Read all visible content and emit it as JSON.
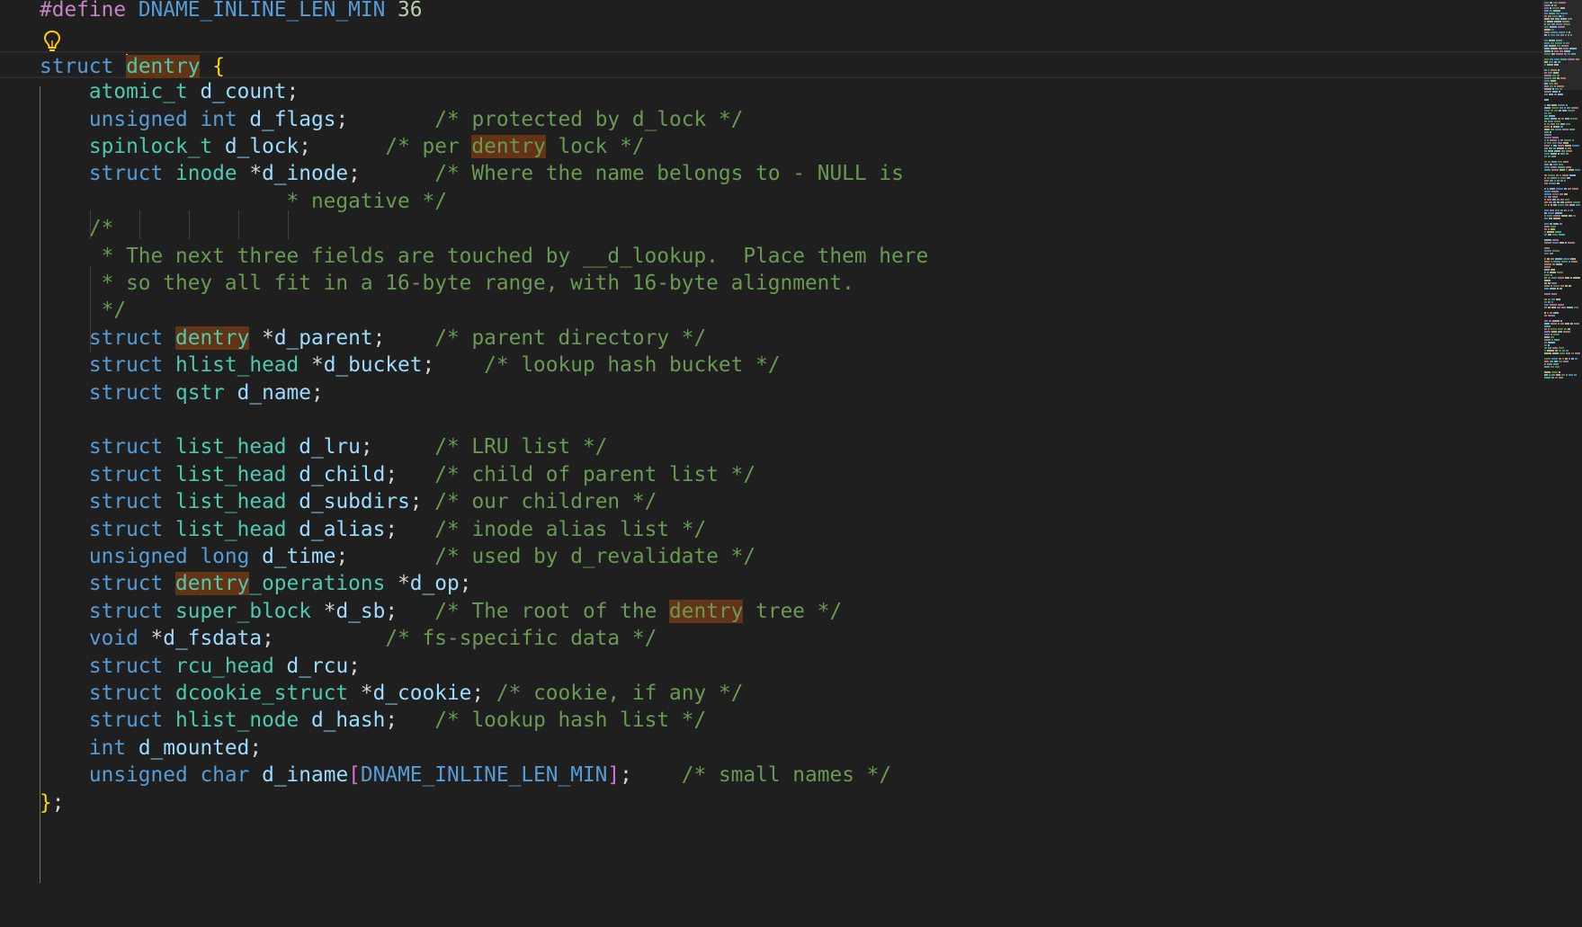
{
  "editor": {
    "language": "c",
    "highlight_word": "dentry",
    "lines": [
      [
        [
          "pp",
          "#define"
        ],
        [
          "pn",
          " "
        ],
        [
          "mac",
          "DNAME_INLINE_LEN_MIN"
        ],
        [
          "pn",
          " "
        ],
        [
          "num",
          "36"
        ]
      ],
      [],
      [
        [
          "kw",
          "struct"
        ],
        [
          "pn",
          " "
        ],
        [
          "caret",
          ""
        ],
        [
          "ty hl",
          "dentry"
        ],
        [
          "pn",
          " "
        ],
        [
          "br",
          "{"
        ]
      ],
      [
        [
          "pn",
          "    "
        ],
        [
          "ty",
          "atomic_t"
        ],
        [
          "pn",
          " "
        ],
        [
          "id",
          "d_count"
        ],
        [
          "pn",
          ";"
        ]
      ],
      [
        [
          "pn",
          "    "
        ],
        [
          "kw",
          "unsigned"
        ],
        [
          "pn",
          " "
        ],
        [
          "kw",
          "int"
        ],
        [
          "pn",
          " "
        ],
        [
          "id",
          "d_flags"
        ],
        [
          "pn",
          ";"
        ],
        [
          "pn",
          "       "
        ],
        [
          "cm",
          "/* protected by d_lock */"
        ]
      ],
      [
        [
          "pn",
          "    "
        ],
        [
          "ty",
          "spinlock_t"
        ],
        [
          "pn",
          " "
        ],
        [
          "id",
          "d_lock"
        ],
        [
          "pn",
          ";"
        ],
        [
          "pn",
          "      "
        ],
        [
          "cm",
          "/* per "
        ],
        [
          "cm hl",
          "dentry"
        ],
        [
          "cm",
          " lock */"
        ]
      ],
      [
        [
          "pn",
          "    "
        ],
        [
          "kw",
          "struct"
        ],
        [
          "pn",
          " "
        ],
        [
          "ty",
          "inode"
        ],
        [
          "pn",
          " *"
        ],
        [
          "id",
          "d_inode"
        ],
        [
          "pn",
          ";"
        ],
        [
          "pn",
          "      "
        ],
        [
          "cm",
          "/* Where the name belongs to - NULL is"
        ]
      ],
      [
        [
          "pn",
          "                    "
        ],
        [
          "cm",
          "* negative */"
        ]
      ],
      [
        [
          "pn",
          "    "
        ],
        [
          "cm",
          "/*"
        ]
      ],
      [
        [
          "pn",
          "    "
        ],
        [
          "cm",
          " * The next three fields are touched by __d_lookup.  Place them here"
        ]
      ],
      [
        [
          "pn",
          "    "
        ],
        [
          "cm",
          " * so they all fit in a 16-byte range, with 16-byte alignment."
        ]
      ],
      [
        [
          "pn",
          "    "
        ],
        [
          "cm",
          " */"
        ]
      ],
      [
        [
          "pn",
          "    "
        ],
        [
          "kw",
          "struct"
        ],
        [
          "pn",
          " "
        ],
        [
          "ty hl",
          "dentry"
        ],
        [
          "pn",
          " *"
        ],
        [
          "id",
          "d_parent"
        ],
        [
          "pn",
          ";"
        ],
        [
          "pn",
          "    "
        ],
        [
          "cm",
          "/* parent directory */"
        ]
      ],
      [
        [
          "pn",
          "    "
        ],
        [
          "kw",
          "struct"
        ],
        [
          "pn",
          " "
        ],
        [
          "ty",
          "hlist_head"
        ],
        [
          "pn",
          " *"
        ],
        [
          "id",
          "d_bucket"
        ],
        [
          "pn",
          ";"
        ],
        [
          "pn",
          "    "
        ],
        [
          "cm",
          "/* lookup hash bucket */"
        ]
      ],
      [
        [
          "pn",
          "    "
        ],
        [
          "kw",
          "struct"
        ],
        [
          "pn",
          " "
        ],
        [
          "ty",
          "qstr"
        ],
        [
          "pn",
          " "
        ],
        [
          "id",
          "d_name"
        ],
        [
          "pn",
          ";"
        ]
      ],
      [],
      [
        [
          "pn",
          "    "
        ],
        [
          "kw",
          "struct"
        ],
        [
          "pn",
          " "
        ],
        [
          "ty",
          "list_head"
        ],
        [
          "pn",
          " "
        ],
        [
          "id",
          "d_lru"
        ],
        [
          "pn",
          ";"
        ],
        [
          "pn",
          "     "
        ],
        [
          "cm",
          "/* LRU list */"
        ]
      ],
      [
        [
          "pn",
          "    "
        ],
        [
          "kw",
          "struct"
        ],
        [
          "pn",
          " "
        ],
        [
          "ty",
          "list_head"
        ],
        [
          "pn",
          " "
        ],
        [
          "id",
          "d_child"
        ],
        [
          "pn",
          ";"
        ],
        [
          "pn",
          "   "
        ],
        [
          "cm",
          "/* child of parent list */"
        ]
      ],
      [
        [
          "pn",
          "    "
        ],
        [
          "kw",
          "struct"
        ],
        [
          "pn",
          " "
        ],
        [
          "ty",
          "list_head"
        ],
        [
          "pn",
          " "
        ],
        [
          "id",
          "d_subdirs"
        ],
        [
          "pn",
          ";"
        ],
        [
          "pn",
          " "
        ],
        [
          "cm",
          "/* our children */"
        ]
      ],
      [
        [
          "pn",
          "    "
        ],
        [
          "kw",
          "struct"
        ],
        [
          "pn",
          " "
        ],
        [
          "ty",
          "list_head"
        ],
        [
          "pn",
          " "
        ],
        [
          "id",
          "d_alias"
        ],
        [
          "pn",
          ";"
        ],
        [
          "pn",
          "   "
        ],
        [
          "cm",
          "/* inode alias list */"
        ]
      ],
      [
        [
          "pn",
          "    "
        ],
        [
          "kw",
          "unsigned"
        ],
        [
          "pn",
          " "
        ],
        [
          "kw",
          "long"
        ],
        [
          "pn",
          " "
        ],
        [
          "id",
          "d_time"
        ],
        [
          "pn",
          ";"
        ],
        [
          "pn",
          "       "
        ],
        [
          "cm",
          "/* used by d_revalidate */"
        ]
      ],
      [
        [
          "pn",
          "    "
        ],
        [
          "kw",
          "struct"
        ],
        [
          "pn",
          " "
        ],
        [
          "ty hl",
          "dentry"
        ],
        [
          "ty",
          "_operations"
        ],
        [
          "pn",
          " *"
        ],
        [
          "id",
          "d_op"
        ],
        [
          "pn",
          ";"
        ]
      ],
      [
        [
          "pn",
          "    "
        ],
        [
          "kw",
          "struct"
        ],
        [
          "pn",
          " "
        ],
        [
          "ty",
          "super_block"
        ],
        [
          "pn",
          " *"
        ],
        [
          "id",
          "d_sb"
        ],
        [
          "pn",
          ";"
        ],
        [
          "pn",
          "   "
        ],
        [
          "cm",
          "/* The root of the "
        ],
        [
          "cm hl",
          "dentry"
        ],
        [
          "cm",
          " tree */"
        ]
      ],
      [
        [
          "pn",
          "    "
        ],
        [
          "kw",
          "void"
        ],
        [
          "pn",
          " *"
        ],
        [
          "id",
          "d_fsdata"
        ],
        [
          "pn",
          ";"
        ],
        [
          "pn",
          "         "
        ],
        [
          "cm",
          "/* fs-specific data */"
        ]
      ],
      [
        [
          "pn",
          "    "
        ],
        [
          "kw",
          "struct"
        ],
        [
          "pn",
          " "
        ],
        [
          "ty",
          "rcu_head"
        ],
        [
          "pn",
          " "
        ],
        [
          "id",
          "d_rcu"
        ],
        [
          "pn",
          ";"
        ]
      ],
      [
        [
          "pn",
          "    "
        ],
        [
          "kw",
          "struct"
        ],
        [
          "pn",
          " "
        ],
        [
          "ty",
          "dcookie_struct"
        ],
        [
          "pn",
          " *"
        ],
        [
          "id",
          "d_cookie"
        ],
        [
          "pn",
          ";"
        ],
        [
          "pn",
          " "
        ],
        [
          "cm",
          "/* cookie, if any */"
        ]
      ],
      [
        [
          "pn",
          "    "
        ],
        [
          "kw",
          "struct"
        ],
        [
          "pn",
          " "
        ],
        [
          "ty",
          "hlist_node"
        ],
        [
          "pn",
          " "
        ],
        [
          "id",
          "d_hash"
        ],
        [
          "pn",
          ";"
        ],
        [
          "pn",
          "   "
        ],
        [
          "cm",
          "/* lookup hash list */"
        ]
      ],
      [
        [
          "pn",
          "    "
        ],
        [
          "kw",
          "int"
        ],
        [
          "pn",
          " "
        ],
        [
          "id",
          "d_mounted"
        ],
        [
          "pn",
          ";"
        ]
      ],
      [
        [
          "pn",
          "    "
        ],
        [
          "kw",
          "unsigned"
        ],
        [
          "pn",
          " "
        ],
        [
          "kw",
          "char"
        ],
        [
          "pn",
          " "
        ],
        [
          "id",
          "d_iname"
        ],
        [
          "br2",
          "["
        ],
        [
          "mac",
          "DNAME_INLINE_LEN_MIN"
        ],
        [
          "br2",
          "]"
        ],
        [
          "pn",
          ";"
        ],
        [
          "pn",
          "    "
        ],
        [
          "cm",
          "/* small names */"
        ]
      ],
      [
        [
          "br",
          "}"
        ],
        [
          "pn",
          ";"
        ]
      ]
    ]
  },
  "colors": {
    "background": "#1f1f1f",
    "keyword": "#569cd6",
    "type": "#4ec9b0",
    "identifier": "#9cdcfe",
    "comment": "#6a9955",
    "preprocessor": "#c586c0",
    "number": "#b5cea8",
    "bracket": "#ffd700",
    "word_highlight": "#623315",
    "lightbulb": "#ffcc00"
  },
  "icons": {
    "gutter": "lightbulb-icon"
  }
}
